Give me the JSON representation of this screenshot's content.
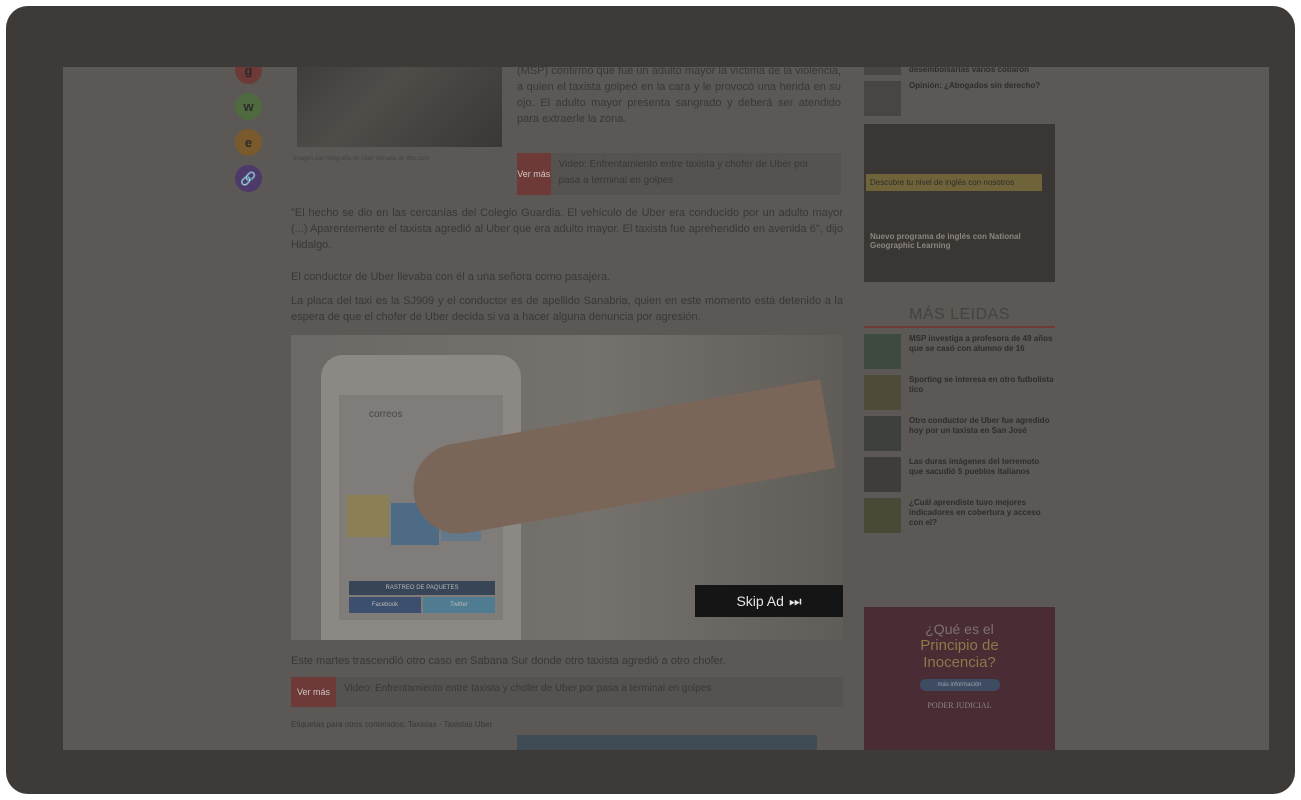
{
  "share_buttons": [
    {
      "icon": "g"
    },
    {
      "icon": "w"
    },
    {
      "icon": "e"
    },
    {
      "icon": "🔗"
    }
  ],
  "article": {
    "image_caption": "Imagen con fotografía de Uber tomada de Bbc.com",
    "lead": "(MSP) confirmó que fue un adulto mayor la víctima de la violencia, a quien el taxista golpeó en la cara y le provocó una herida en su ojo. El adulto mayor presenta sangrado y deberá ser atendido para extraerle la zona.",
    "related_1": {
      "ver_label": "Ver más",
      "text": "Video: Enfrentamiento entre taxista y chofer de Uber por pasa a terminal en golpes"
    },
    "para_1": "\"El hecho se dio en las cercanías del Colegio Guardia. El vehículo de Uber era conducido por un adulto mayor (...) Aparentemente el taxista agredió al Uber que era adulto mayor. El taxista fue aprehendido en avenida 6\", dijo Hidalgo.",
    "para_2": "El conductor de Uber llevaba con él a una señora como pasajera.",
    "para_3": "La placa del taxi es la SJ909 y el conductor es de apellido Sanabria, quien en este momento está detenido a la espera de que el chofer de Uber decida si va a hacer alguna denuncia por agresión.",
    "video": {
      "app_title": "correos",
      "app_banner": "RASTREO DE PAQUETES",
      "app_left": "Facebook",
      "app_right": "Twitter",
      "skip_label": "Skip Ad",
      "skip_icon": "⏭"
    },
    "para_4": "Este martes trascendió otro caso en Sabana Sur donde otro taxista agredió a otro chofer.",
    "related_2": {
      "ver_label": "Ver más",
      "text": "Video: Enfrentamiento entre taxista y chofer de Uber por pasa a terminal en golpes"
    },
    "tags_line": "Etiquetas para otros contenidos: Taxistas · Taxistas Uber"
  },
  "sidebar": {
    "top_items": [
      {
        "title": "desembolsarlas varios cobarón"
      },
      {
        "title": "Opinión: ¿Abogados sin derecho?"
      }
    ],
    "ad1_text_1": "Descubre tu nivel de inglés con nosotros",
    "ad1_text_2": "Nuevo programa de inglés con National Geographic Learning",
    "mas_leidas_title": "MÁS LEIDAS",
    "mas_leidas": [
      {
        "title": "MSP investiga a profesora de 49 años que se casó con alumno de 16"
      },
      {
        "title": "Sporting se interesa en otro futbolista tico"
      },
      {
        "title": "Otro conductor de Uber fue agredido hoy por un taxista en San José"
      },
      {
        "title": "Las duras imágenes del terremoto que sacudió 5 pueblos italianos"
      },
      {
        "title": "¿Cuál aprendiste tuvo mejores indicadores en cobertura y acceso con el?"
      }
    ],
    "ad2_line1": "¿Qué es el",
    "ad2_line2": "Principio de",
    "ad2_line3": "Inocencia?",
    "ad2_button": "más información",
    "ad2_brand": "PODER JUDICIAL"
  },
  "colors": {
    "overlay_bg": "#5b5856",
    "frame": "#3d3a37",
    "accent_red": "#6e3a38"
  }
}
